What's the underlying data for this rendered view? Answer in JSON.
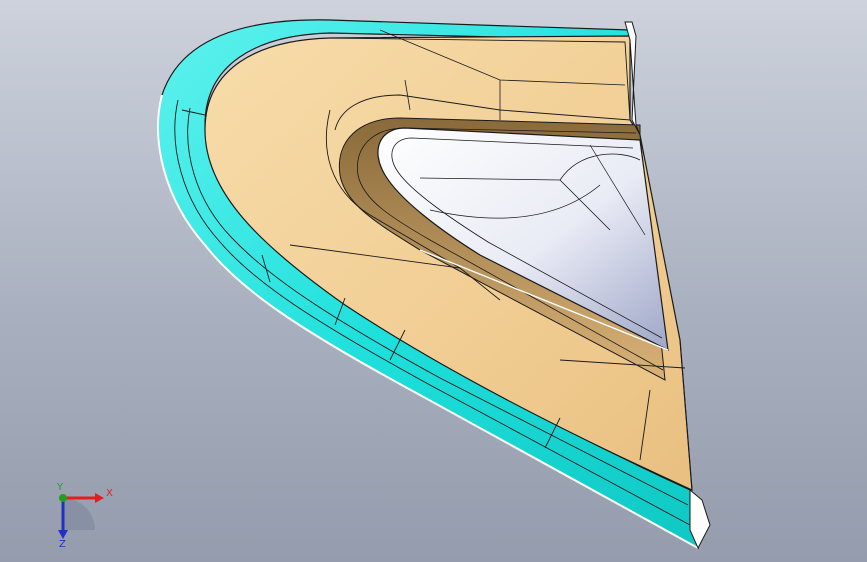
{
  "viewport": {
    "background_top": "#cdd2dc",
    "background_bottom": "#949cad"
  },
  "model": {
    "face_color": "#f3d19a",
    "flange_color": "#2ee6e0",
    "pocket_color": "#ffffff",
    "edge_color": "#1a1a1a"
  },
  "triad": {
    "x_label": "X",
    "y_label": "Y",
    "z_label": "Z",
    "x_color": "#e02020",
    "y_color": "#20a020",
    "z_color": "#2030c0"
  }
}
